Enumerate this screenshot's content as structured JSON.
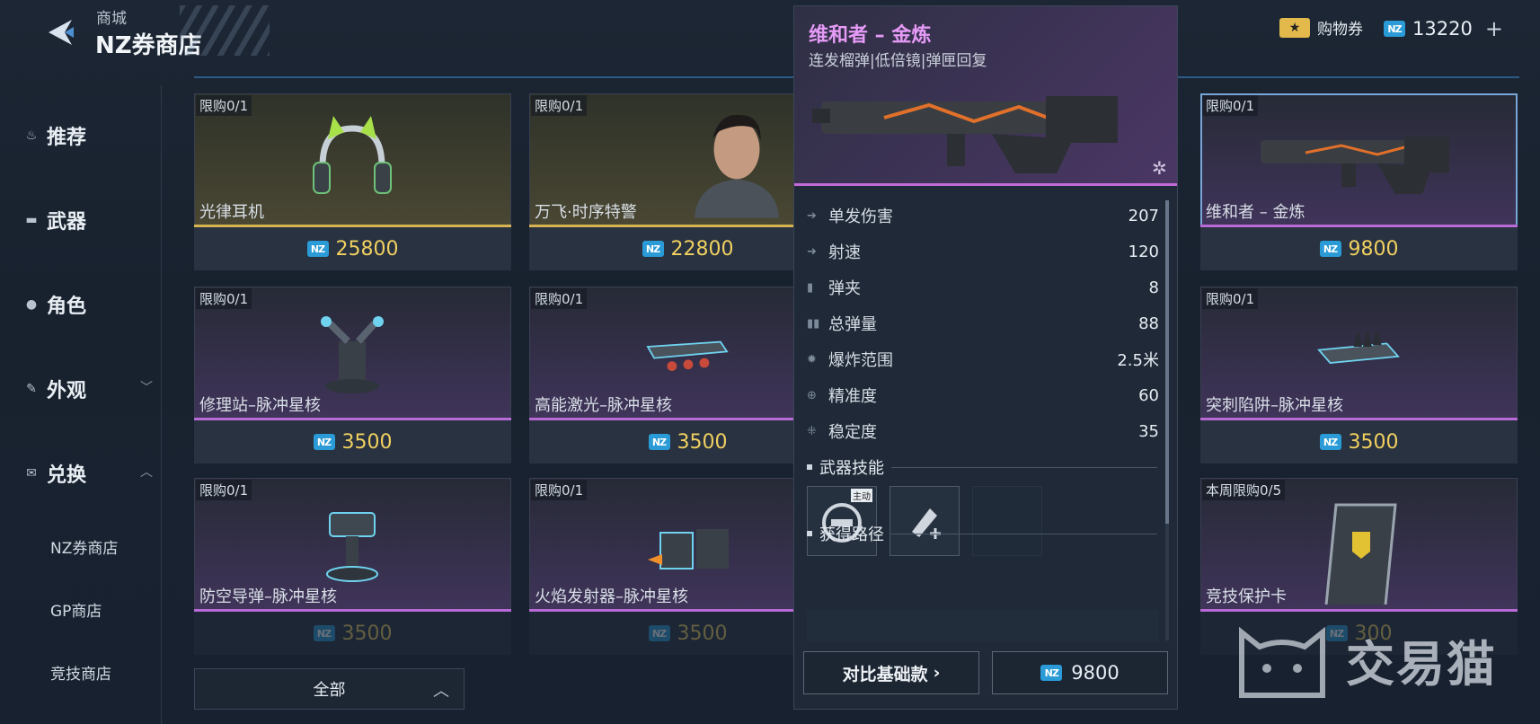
{
  "header": {
    "breadcrumb": "商城",
    "title": "NZ券商店",
    "voucher_label": "购物券",
    "balance": "13220",
    "plus": "+"
  },
  "sidebar": {
    "items": [
      {
        "label": "推荐",
        "icon": "flame-icon"
      },
      {
        "label": "武器",
        "icon": "gun-icon"
      },
      {
        "label": "角色",
        "icon": "person-icon"
      },
      {
        "label": "外观",
        "icon": "spray-icon"
      },
      {
        "label": "兑换",
        "icon": "ticket-icon"
      }
    ],
    "sub_items": [
      "NZ券商店",
      "GP商店",
      "竞技商店"
    ]
  },
  "grid": {
    "cards": [
      {
        "tag": "限购0/1",
        "name": "光律耳机",
        "price": "25800"
      },
      {
        "tag": "限购0/1",
        "name": "万飞·时序特警",
        "price": "22800"
      },
      {
        "tag": "限购0/1",
        "name": "维和者 – 金炼",
        "price": "9800"
      },
      {
        "tag": "限购0/1",
        "name": "修理站–脉冲星核",
        "price": "3500"
      },
      {
        "tag": "限购0/1",
        "name": "高能激光–脉冲星核",
        "price": "3500"
      },
      {
        "tag": "限购0/1",
        "name": "突刺陷阱–脉冲星核",
        "price": "3500"
      },
      {
        "tag": "限购0/1",
        "name": "防空导弹–脉冲星核",
        "price": "3500"
      },
      {
        "tag": "限购0/1",
        "name": "火焰发射器–脉冲星核",
        "price": "3500"
      },
      {
        "tag": "本周限购0/5",
        "name": "竞技保护卡",
        "price": "300"
      }
    ]
  },
  "popup": {
    "title": "维和者 – 金炼",
    "subtitle": "连发榴弹|低倍镜|弹匣回复",
    "stats": [
      {
        "label": "单发伤害",
        "value": "207"
      },
      {
        "label": "射速",
        "value": "120"
      },
      {
        "label": "弹夹",
        "value": "8"
      },
      {
        "label": "总弹量",
        "value": "88"
      },
      {
        "label": "爆炸范围",
        "value": "2.5米"
      },
      {
        "label": "精准度",
        "value": "60"
      },
      {
        "label": "稳定度",
        "value": "35"
      }
    ],
    "skills_header": "武器技能",
    "skill_badge": "主动",
    "source_header": "获得路径",
    "compare_label": "对比基础款",
    "price": "9800"
  },
  "filter": {
    "label": "全部"
  },
  "watermark": {
    "text": "交易猫"
  },
  "colors": {
    "accent_purple": "#c36ad8",
    "gold": "#d7b352",
    "price_yellow": "#f0d060",
    "coin_blue": "#2a9bd6"
  }
}
